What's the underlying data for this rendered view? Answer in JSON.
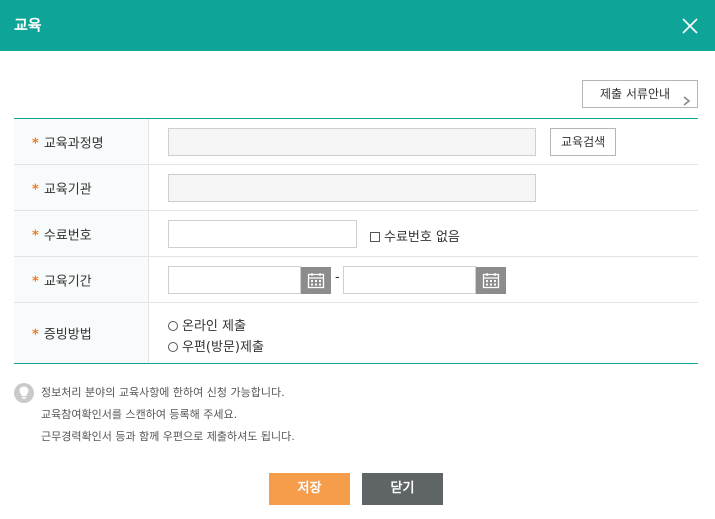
{
  "dialog": {
    "title": "교육",
    "close_icon": "close-icon",
    "guide_button_label": "제출 서류안내",
    "guide_button_icon": "chevron-right-icon"
  },
  "form": {
    "required_mark": "*",
    "course_name": {
      "label": "교육과정명",
      "value": "",
      "search_button_label": "교육검색"
    },
    "institution": {
      "label": "교육기관",
      "value": ""
    },
    "cert_number": {
      "label": "수료번호",
      "value": "",
      "no_number_label": "수료번호 없음",
      "no_number_checked": false
    },
    "period": {
      "label": "교육기간",
      "start": "",
      "end": "",
      "separator": "-",
      "calendar_icon": "calendar-icon"
    },
    "proof_method": {
      "label": "증빙방법",
      "options": [
        "온라인 제출",
        "우편(방문)제출"
      ],
      "selected": null
    }
  },
  "notice": {
    "icon": "lightbulb-icon",
    "lines": [
      "정보처리 분야의 교육사항에 한하여 신청 가능합니다.",
      "교육참여확인서를 스캔하여 등록해 주세요.",
      "근무경력확인서 등과 함께 우편으로 제출하셔도 됩니다."
    ]
  },
  "actions": {
    "save_label": "저장",
    "close_label": "닫기"
  },
  "colors": {
    "header": "#0ea598",
    "required": "#f07a23",
    "save": "#f69d4b",
    "close": "#5f6466",
    "calendar": "#8c8c8c"
  }
}
